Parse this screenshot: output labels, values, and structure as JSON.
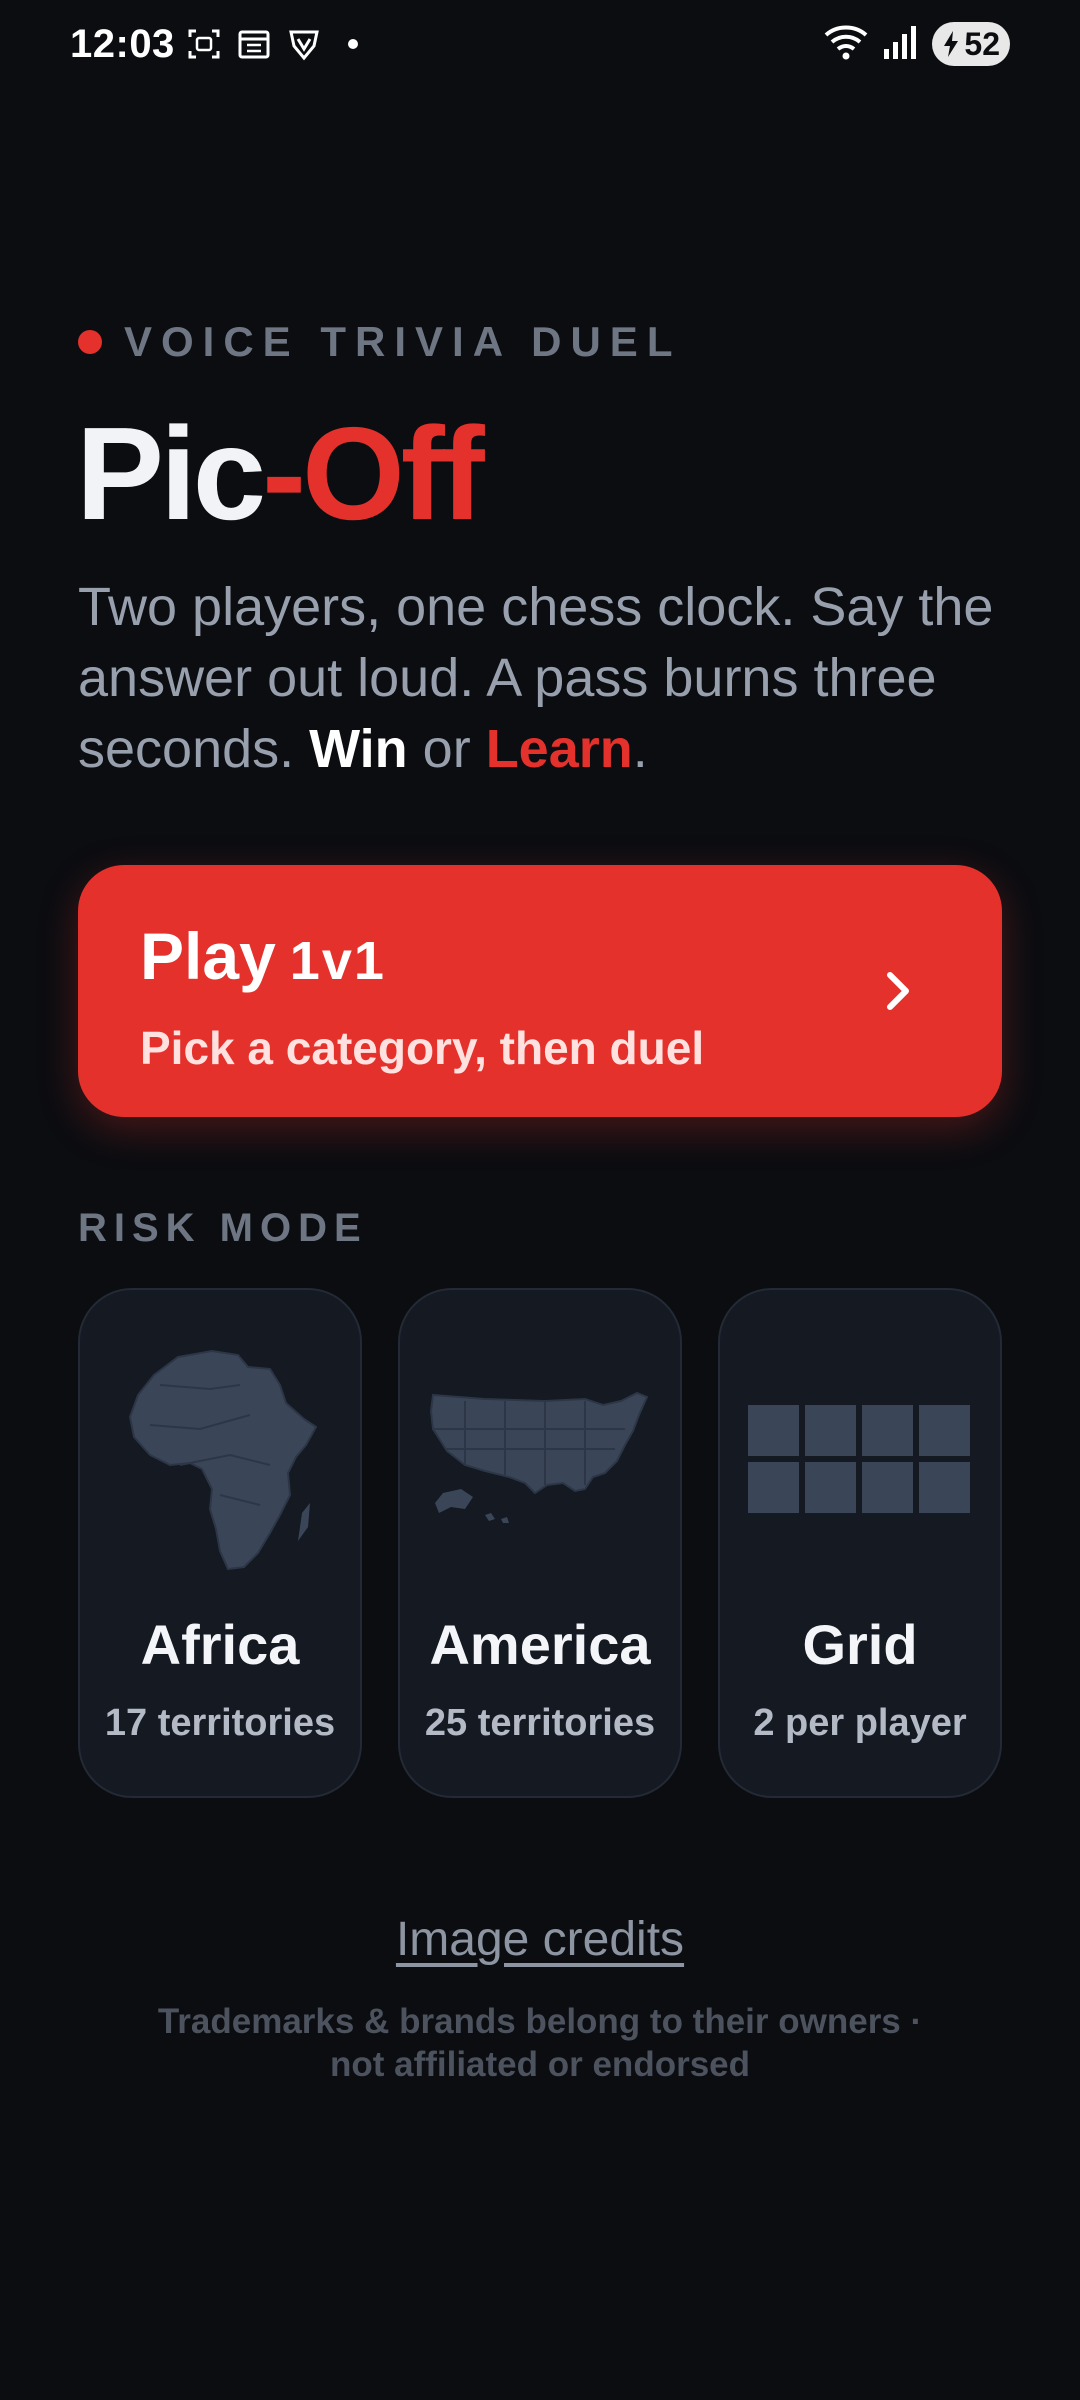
{
  "status_bar": {
    "time": "12:03",
    "battery": "52",
    "icons": [
      "screenshot-icon",
      "calendar-icon",
      "vpn-shield-icon",
      "notification-dot",
      "wifi-icon",
      "signal-icon",
      "battery-icon"
    ]
  },
  "header": {
    "kicker": "VOICE TRIVIA DUEL",
    "title_part1": "Pic",
    "title_part2": "-Off",
    "desc_text": "Two players, one chess clock. Say the answer out loud. A pass burns three seconds.",
    "desc_win": "Win",
    "desc_or": "or",
    "desc_learn": "Learn",
    "desc_end": "."
  },
  "play_button": {
    "title": "Play",
    "tag": "1v1",
    "subtitle": "Pick a category, then duel"
  },
  "risk_mode": {
    "label": "RISK MODE",
    "cards": [
      {
        "title": "Africa",
        "subtitle": "17 territories",
        "icon": "africa-map-icon"
      },
      {
        "title": "America",
        "subtitle": "25 territories",
        "icon": "usa-map-icon"
      },
      {
        "title": "Grid",
        "subtitle": "2 per player",
        "icon": "grid-icon"
      }
    ]
  },
  "footer": {
    "credits": "Image credits",
    "disclaimer": "Trademarks & brands belong to their owners · not affiliated or endorsed"
  },
  "colors": {
    "background": "#0b0d11",
    "accent": "#e5312c",
    "card": "#141922",
    "muted": "#6e7683"
  }
}
